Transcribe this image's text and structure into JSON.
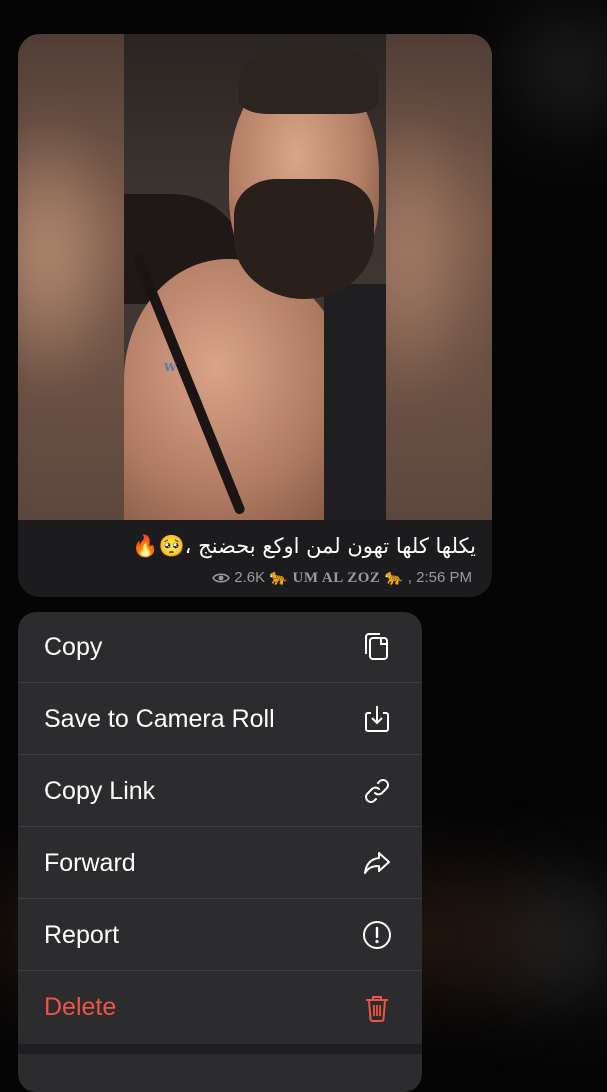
{
  "message": {
    "caption": "يكلها كلها تهون لمن اوكع بحضنج ،🥺🔥",
    "views": "2.6K",
    "channel": "🐆 UM AL ZOZ 🐆",
    "time": ", 2:56 PM",
    "watermark": "W"
  },
  "menu": {
    "items": [
      {
        "label": "Copy",
        "icon": "copy-icon"
      },
      {
        "label": "Save to Camera Roll",
        "icon": "download-icon"
      },
      {
        "label": "Copy Link",
        "icon": "link-icon"
      },
      {
        "label": "Forward",
        "icon": "forward-arrow-icon"
      },
      {
        "label": "Report",
        "icon": "exclamation-circle-icon"
      },
      {
        "label": "Delete",
        "icon": "trash-icon"
      }
    ]
  },
  "colors": {
    "danger": "#eb5545",
    "menu_bg": "#2c2c2e",
    "meta": "#9a9a9e"
  }
}
